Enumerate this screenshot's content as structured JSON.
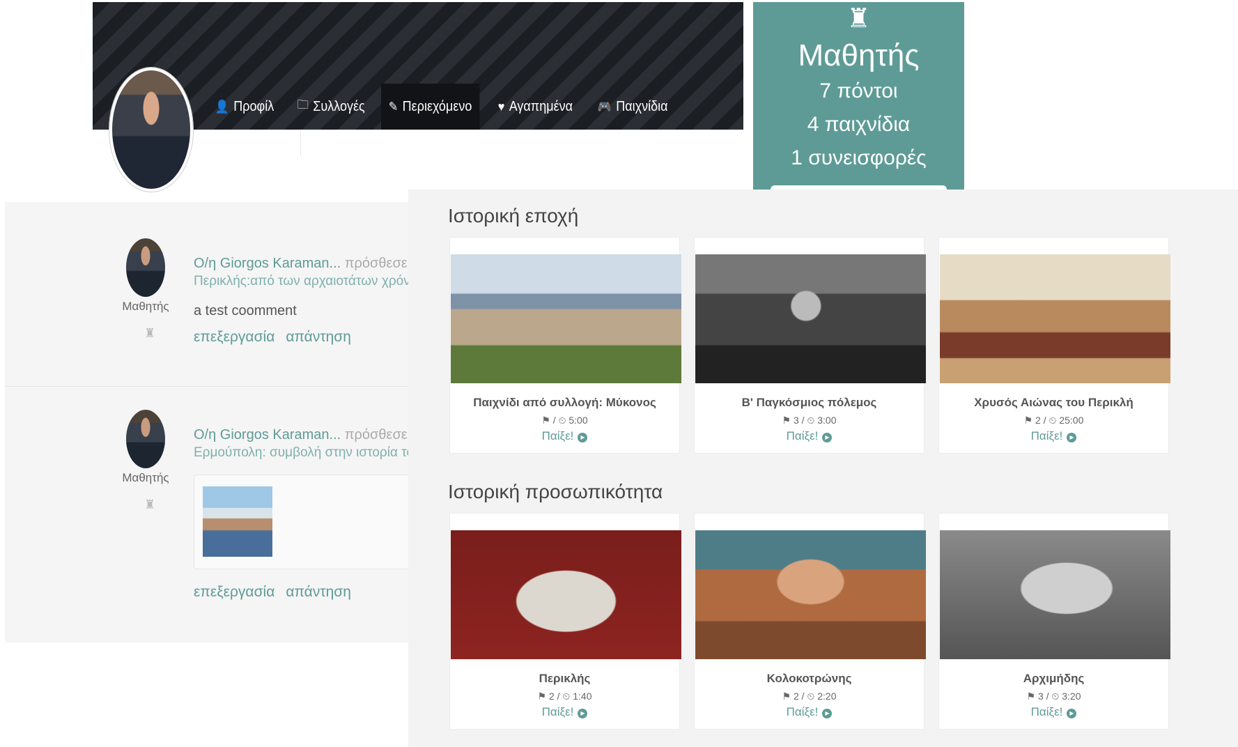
{
  "profile": {
    "nav": [
      {
        "icon": "user-icon",
        "glyph": "👤",
        "label": "Προφίλ",
        "active": false
      },
      {
        "icon": "folder-icon",
        "glyph": "🗀",
        "label": "Συλλογές",
        "active": false
      },
      {
        "icon": "edit-icon",
        "glyph": "✎",
        "label": "Περιεχόμενο",
        "active": true
      },
      {
        "icon": "heart-icon",
        "glyph": "♥",
        "label": "Αγαπημένα",
        "active": false
      },
      {
        "icon": "gamepad-icon",
        "glyph": "🎮",
        "label": "Παιχνίδια",
        "active": false
      }
    ]
  },
  "rank": {
    "icon": "chef-hat-icon",
    "title": "Μαθητής",
    "points": "7 πόντοι",
    "games": "4 παιχνίδια",
    "contributions": "1 συνεισφορές"
  },
  "feed": [
    {
      "role": "Μαθητής",
      "user": "O/η Giorgos Karaman...",
      "action": " πρόσθεσε το ακόλο",
      "target": "Περικλής:από των αρχαιοτάτων χρόνων μέχρ",
      "comment": "a test coomment",
      "edit_label": "επεξεργασία",
      "reply_label": "απάντηση"
    },
    {
      "role": "Μαθητής",
      "user": "O/η Giorgos Karaman...",
      "action": " πρόσθεσε το ακόλο",
      "target": "Ερμούπολη: συμβολή στην ιστορία του νησιοι",
      "edit_label": "επεξεργασία",
      "reply_label": "απάντηση"
    }
  ],
  "sections": [
    {
      "title": "Ιστορική εποχή",
      "cards": [
        {
          "title": "Παιχνίδι από συλλογή: Μύκονος",
          "meta": " / ⏲ 5:00",
          "play": "Παίξε!",
          "image": "img-delos"
        },
        {
          "title": "Β' Παγκόσμιος πόλεμος",
          "meta": " 3 / ⏲ 3:00",
          "play": "Παίξε!",
          "image": "img-ww2"
        },
        {
          "title": "Χρυσός Αιώνας του Περικλή",
          "meta": " 2 / ⏲ 25:00",
          "play": "Παίξε!",
          "image": "img-pericles-speech"
        }
      ]
    },
    {
      "title": "Ιστορική προσωπικότητα",
      "cards": [
        {
          "title": "Περικλής",
          "meta": " 2 / ⏲ 1:40",
          "play": "Παίξε!",
          "image": "img-bust"
        },
        {
          "title": "Κολοκοτρώνης",
          "meta": " 2 / ⏲ 2:20",
          "play": "Παίξε!",
          "image": "img-kolo"
        },
        {
          "title": "Αρχιμήδης",
          "meta": " 3 / ⏲ 3:20",
          "play": "Παίξε!",
          "image": "img-arch"
        }
      ]
    }
  ],
  "colors": {
    "accent": "#5e9b96",
    "banner": "#1b1e22",
    "panel_bg": "#f3f3f3"
  }
}
